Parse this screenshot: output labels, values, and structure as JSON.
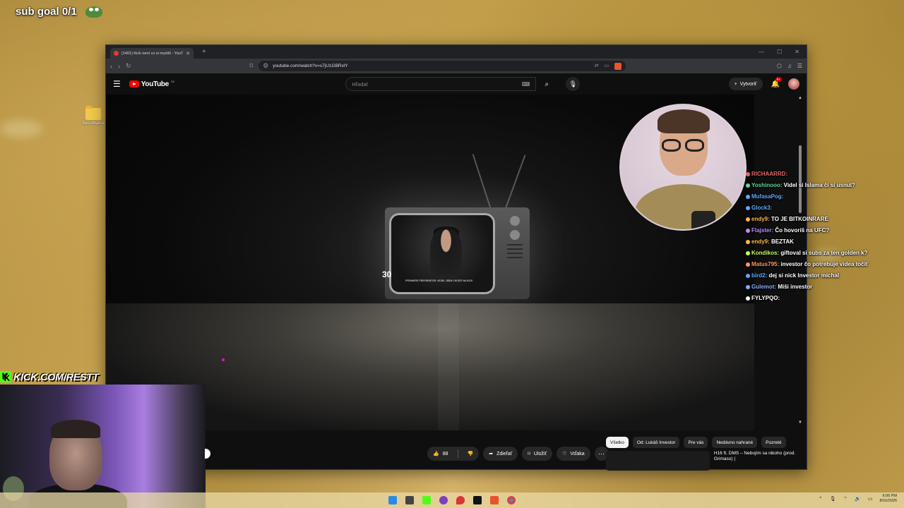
{
  "overlay": {
    "sub_goal": "sub goal 0/1",
    "kick_handle": "KICK.COM/RESTT",
    "kick_k": "K"
  },
  "desktop": {
    "folder_label": "Bezobsahu"
  },
  "browser": {
    "tab_title": "(1401) Kick není co si myslíš - YouTube",
    "url": "youtube.com/watch?v=s7jU1GBRxlY",
    "ext_badge": "8"
  },
  "youtube": {
    "logo_text": "YouTube",
    "country_code": "SK",
    "search_placeholder": "Hľadať",
    "create_label": "Vytvoriť",
    "notification_count": "9+",
    "video_number": "30",
    "video_caption": "PREMIERE PREPÁRATOR: VIDIEL JSEM CHODIT NA KICK",
    "actions": {
      "like_count": "88",
      "share": "Zdieľať",
      "save": "Uložiť",
      "thanks": "Vďaka"
    },
    "chips": [
      "Všetko",
      "Od: Lukáš Investor",
      "Pre vás",
      "Nedávno nahrané",
      "Pozreté"
    ],
    "recommendation_title": "H16 ft. DMS – Nebojím sa nikoho (prod. Grimaso) |"
  },
  "chat": [
    {
      "user": "RICHAARRD:",
      "message": "",
      "color": "#e06666"
    },
    {
      "user": "Yoshinooo:",
      "message": "Videl si Islama či si usnul?",
      "color": "#5ad9a0"
    },
    {
      "user": "MufasaPog:",
      "message": "",
      "color": "#5da8ff"
    },
    {
      "user": "Glock3:",
      "message": "",
      "color": "#5da8ff"
    },
    {
      "user": "endy9:",
      "message": "TO JE BITKOINRARE",
      "color": "#ffb84d"
    },
    {
      "user": "Flajster:",
      "message": "Čo hovoríš na UFC?",
      "color": "#b98cff"
    },
    {
      "user": "endy9:",
      "message": "BEZTAK",
      "color": "#ffb84d"
    },
    {
      "user": "Kondikos:",
      "message": "giftoval si subs za ten golden k?",
      "color": "#c8ff5a"
    },
    {
      "user": "Matus795:",
      "message": "investor čo potrebuje videa točiť",
      "color": "#ff9a5a"
    },
    {
      "user": "bird2:",
      "message": "dej si nick Investor michal",
      "color": "#5da8ff"
    },
    {
      "user": "Gulemot:",
      "message": "Miši investor",
      "color": "#88aaff"
    },
    {
      "user": "FYLYPQO:",
      "message": "",
      "color": "#ffffff"
    }
  ],
  "taskbar": {
    "time": "6:06 PM",
    "date": "8/16/2026"
  },
  "colors": {
    "yt_red": "#ff0000",
    "kick_green": "#53fc18"
  }
}
